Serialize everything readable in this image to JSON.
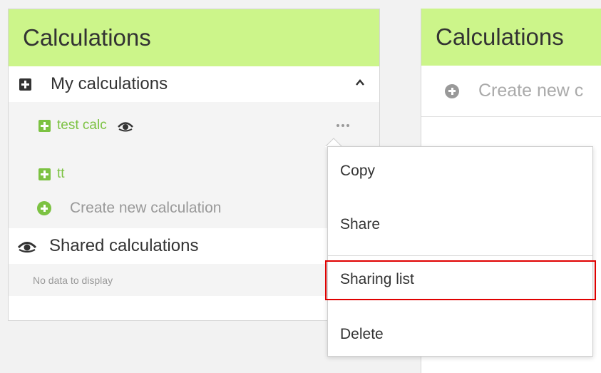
{
  "left_panel": {
    "title": "Calculations",
    "my_calculations": {
      "label": "My calculations",
      "items": [
        {
          "label": "test calc",
          "shared": true
        },
        {
          "label": "tt",
          "shared": false
        }
      ],
      "create_label": "Create new calculation"
    },
    "shared_calculations": {
      "label": "Shared calculations",
      "empty_text": "No data to display"
    }
  },
  "right_panel": {
    "title": "Calculations",
    "create_label": "Create new c"
  },
  "context_menu": {
    "items": [
      "Copy",
      "Share",
      "Sharing list",
      "Delete"
    ],
    "highlighted": "Sharing list"
  },
  "colors": {
    "header_bg": "#ccf58a",
    "accent_green": "#7cc242",
    "highlight_red": "#e00000"
  },
  "icons": [
    "plus-square-icon",
    "chevron-up-icon",
    "eye-icon",
    "more-dots-icon",
    "plus-circle-icon"
  ]
}
